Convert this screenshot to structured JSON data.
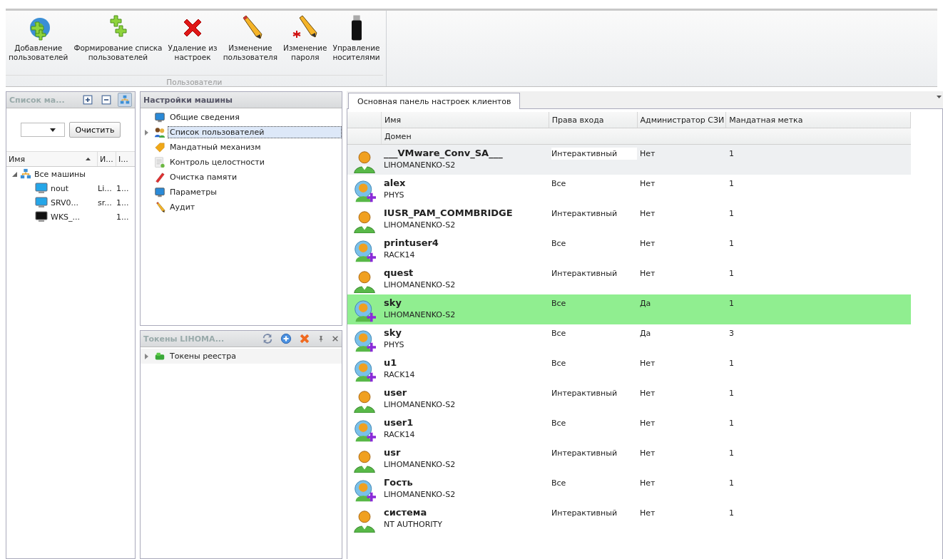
{
  "ribbon": {
    "buttons": [
      {
        "kind": "globe-add",
        "label": "Добавление\nпользователей"
      },
      {
        "kind": "plus-pair",
        "label": "Формирование списка\nпользователей"
      },
      {
        "kind": "cross",
        "label": "Удаление из\nнастроек"
      },
      {
        "kind": "pencil",
        "label": "Изменение\nпользователя"
      },
      {
        "kind": "pencil-star",
        "label": "Изменение\nпароля"
      },
      {
        "kind": "usb",
        "label": "Управление\nносителями"
      }
    ],
    "group_label": "Пользователи"
  },
  "machines_panel": {
    "title": "Список ма...",
    "tools": [
      {
        "kind": "expand",
        "selected": false
      },
      {
        "kind": "collapse",
        "selected": false
      },
      {
        "kind": "network",
        "selected": true
      }
    ],
    "clear_button": "Очистить",
    "columns": [
      "Имя",
      "И...",
      "I..."
    ],
    "tree": [
      {
        "name": "Все машины",
        "kind": "network",
        "expanded": true,
        "children": [
          {
            "name": "nout",
            "kind": "online",
            "col_2": "Li...",
            "col_3": "1..."
          },
          {
            "name": "SRV0...",
            "kind": "online",
            "col_2": "sr...",
            "col_3": "1..."
          },
          {
            "name": "WKS_...",
            "kind": "offline",
            "col_3": "1..."
          }
        ]
      }
    ]
  },
  "settings_panel": {
    "title": "Настройки машины",
    "items": [
      {
        "label": "Общие сведения",
        "kind": "monitor",
        "collapsed": false,
        "selected": false
      },
      {
        "label": "Список пользователей",
        "kind": "users",
        "collapsed": true,
        "selected": true
      },
      {
        "label": "Мандатный механизм",
        "kind": "tag",
        "collapsed": false,
        "selected": false
      },
      {
        "label": "Контроль целостности",
        "kind": "sheet",
        "collapsed": false,
        "selected": false
      },
      {
        "label": "Очистка памяти",
        "kind": "eraser",
        "collapsed": false,
        "selected": false
      },
      {
        "label": "Параметры",
        "kind": "monitor",
        "collapsed": false,
        "selected": false
      },
      {
        "label": "Аудит",
        "kind": "pencil",
        "collapsed": false,
        "selected": false
      }
    ]
  },
  "tokens_panel": {
    "title": "Токены LIHOMA...",
    "items": [
      {
        "label": "Токены реестра",
        "collapsed": true
      }
    ]
  },
  "main": {
    "tab": {
      "label": "Основная панель настроек клиентов",
      "selected": true
    },
    "columns": [
      "Имя",
      "Права входа",
      "Администратор СЗИ",
      "Мандатная метка"
    ],
    "sub_column": "Домен",
    "rows": [
      {
        "kind": "local",
        "name": "___VMware_Conv_SA___",
        "domain": "LIHOMANENKO-S2",
        "rights": "Интерактивный",
        "admin": "Нет",
        "label": "1",
        "selected": true,
        "highlighted": false
      },
      {
        "kind": "domain",
        "name": "alex",
        "domain": "PHYS",
        "rights": "Все",
        "admin": "Нет",
        "label": "1",
        "selected": false,
        "highlighted": false
      },
      {
        "kind": "local",
        "name": "IUSR_PAM_COMMBRIDGE",
        "domain": "LIHOMANENKO-S2",
        "rights": "Интерактивный",
        "admin": "Нет",
        "label": "1",
        "selected": false,
        "highlighted": false
      },
      {
        "kind": "domain",
        "name": "printuser4",
        "domain": "RACK14",
        "rights": "Все",
        "admin": "Нет",
        "label": "1",
        "selected": false,
        "highlighted": false
      },
      {
        "kind": "local",
        "name": "quest",
        "domain": "LIHOMANENKO-S2",
        "rights": "Интерактивный",
        "admin": "Нет",
        "label": "1",
        "selected": false,
        "highlighted": false
      },
      {
        "kind": "domain",
        "name": "sky",
        "domain": "LIHOMANENKO-S2",
        "rights": "Все",
        "admin": "Да",
        "label": "1",
        "selected": false,
        "highlighted": true
      },
      {
        "kind": "domain",
        "name": "sky",
        "domain": "PHYS",
        "rights": "Все",
        "admin": "Да",
        "label": "3",
        "selected": false,
        "highlighted": false
      },
      {
        "kind": "domain",
        "name": "u1",
        "domain": "RACK14",
        "rights": "Все",
        "admin": "Нет",
        "label": "1",
        "selected": false,
        "highlighted": false
      },
      {
        "kind": "local",
        "name": "user",
        "domain": "LIHOMANENKO-S2",
        "rights": "Интерактивный",
        "admin": "Нет",
        "label": "1",
        "selected": false,
        "highlighted": false
      },
      {
        "kind": "domain",
        "name": "user1",
        "domain": "RACK14",
        "rights": "Все",
        "admin": "Нет",
        "label": "1",
        "selected": false,
        "highlighted": false
      },
      {
        "kind": "local",
        "name": "usr",
        "domain": "LIHOMANENKO-S2",
        "rights": "Интерактивный",
        "admin": "Нет",
        "label": "1",
        "selected": false,
        "highlighted": false
      },
      {
        "kind": "domain",
        "name": "Гость",
        "domain": "LIHOMANENKO-S2",
        "rights": "Все",
        "admin": "Нет",
        "label": "1",
        "selected": false,
        "highlighted": false
      },
      {
        "kind": "local",
        "name": "система",
        "domain": "NT AUTHORITY",
        "rights": "Интерактивный",
        "admin": "Нет",
        "label": "1",
        "selected": false,
        "highlighted": false
      }
    ]
  }
}
